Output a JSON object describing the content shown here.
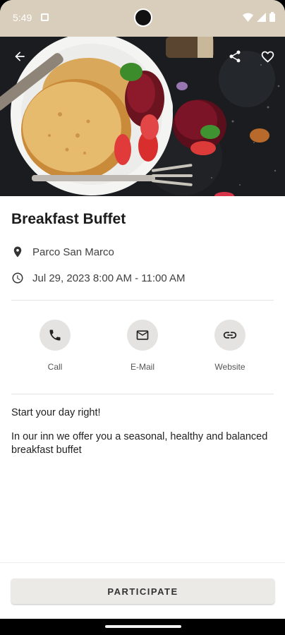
{
  "status_bar": {
    "time": "5:49"
  },
  "event": {
    "title": "Breakfast Buffet",
    "location": "Parco San Marco",
    "datetime": "Jul 29, 2023 8:00 AM - 11:00 AM",
    "tagline": "Start your day right!",
    "description": "In our inn we offer you a seasonal, healthy and balanced breakfast buffet"
  },
  "actions": [
    {
      "label": "Call",
      "icon": "phone-icon"
    },
    {
      "label": "E-Mail",
      "icon": "mail-icon"
    },
    {
      "label": "Website",
      "icon": "link-icon"
    }
  ],
  "primary_button": {
    "label": "PARTICIPATE"
  },
  "colors": {
    "status_bar": "#d9cebb",
    "button_bg": "#eceae6",
    "icon_circle": "#e4e3e1"
  }
}
